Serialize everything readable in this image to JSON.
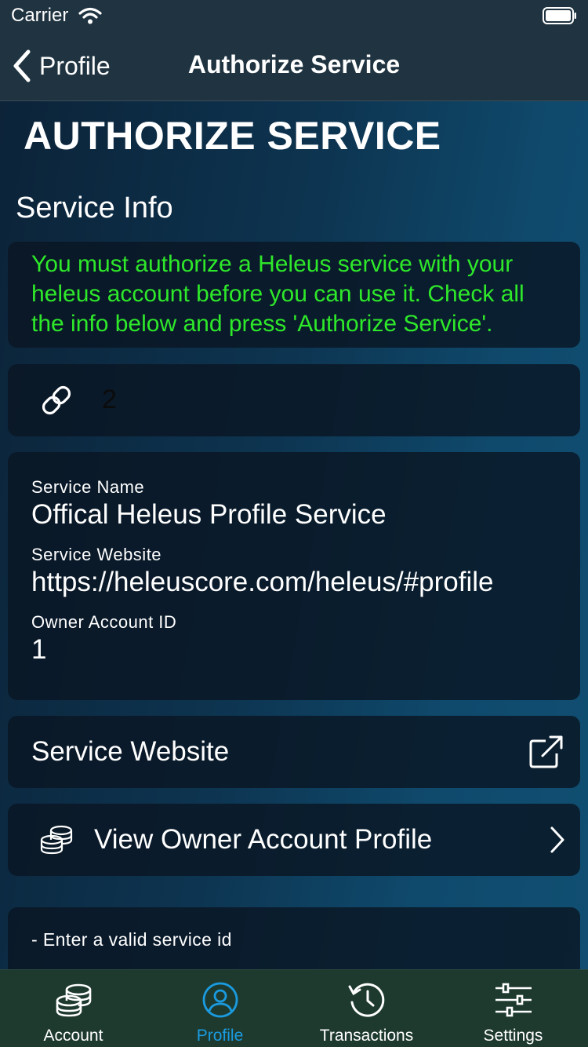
{
  "status_bar": {
    "carrier": "Carrier"
  },
  "nav": {
    "back_label": "Profile",
    "title": "Authorize Service"
  },
  "page": {
    "heading": "AUTHORIZE SERVICE",
    "section_title": "Service Info",
    "info_message": "You must authorize a Heleus service with your heleus account before you can use it. Check all the info below and press 'Authorize Service'.",
    "service_id": "2"
  },
  "details": {
    "service_name_label": "Service Name",
    "service_name": "Offical Heleus Profile Service",
    "service_website_label": "Service Website",
    "service_website": "https://heleuscore.com/heleus/#profile",
    "owner_account_label": "Owner Account ID",
    "owner_account_id": "1"
  },
  "actions": {
    "service_website": "Service Website",
    "view_owner_profile": "View Owner Account Profile"
  },
  "errors": {
    "message": "- Enter a valid service id"
  },
  "tabs": [
    {
      "label": "Account",
      "icon": "coins-icon"
    },
    {
      "label": "Profile",
      "icon": "profile-icon",
      "active": true
    },
    {
      "label": "Transactions",
      "icon": "history-icon"
    },
    {
      "label": "Settings",
      "icon": "sliders-icon"
    }
  ],
  "colors": {
    "accent": "#1a9be0",
    "info_text": "#2ee82a",
    "tab_bar": "#1e3a2f",
    "nav_bar": "#1f3340"
  }
}
